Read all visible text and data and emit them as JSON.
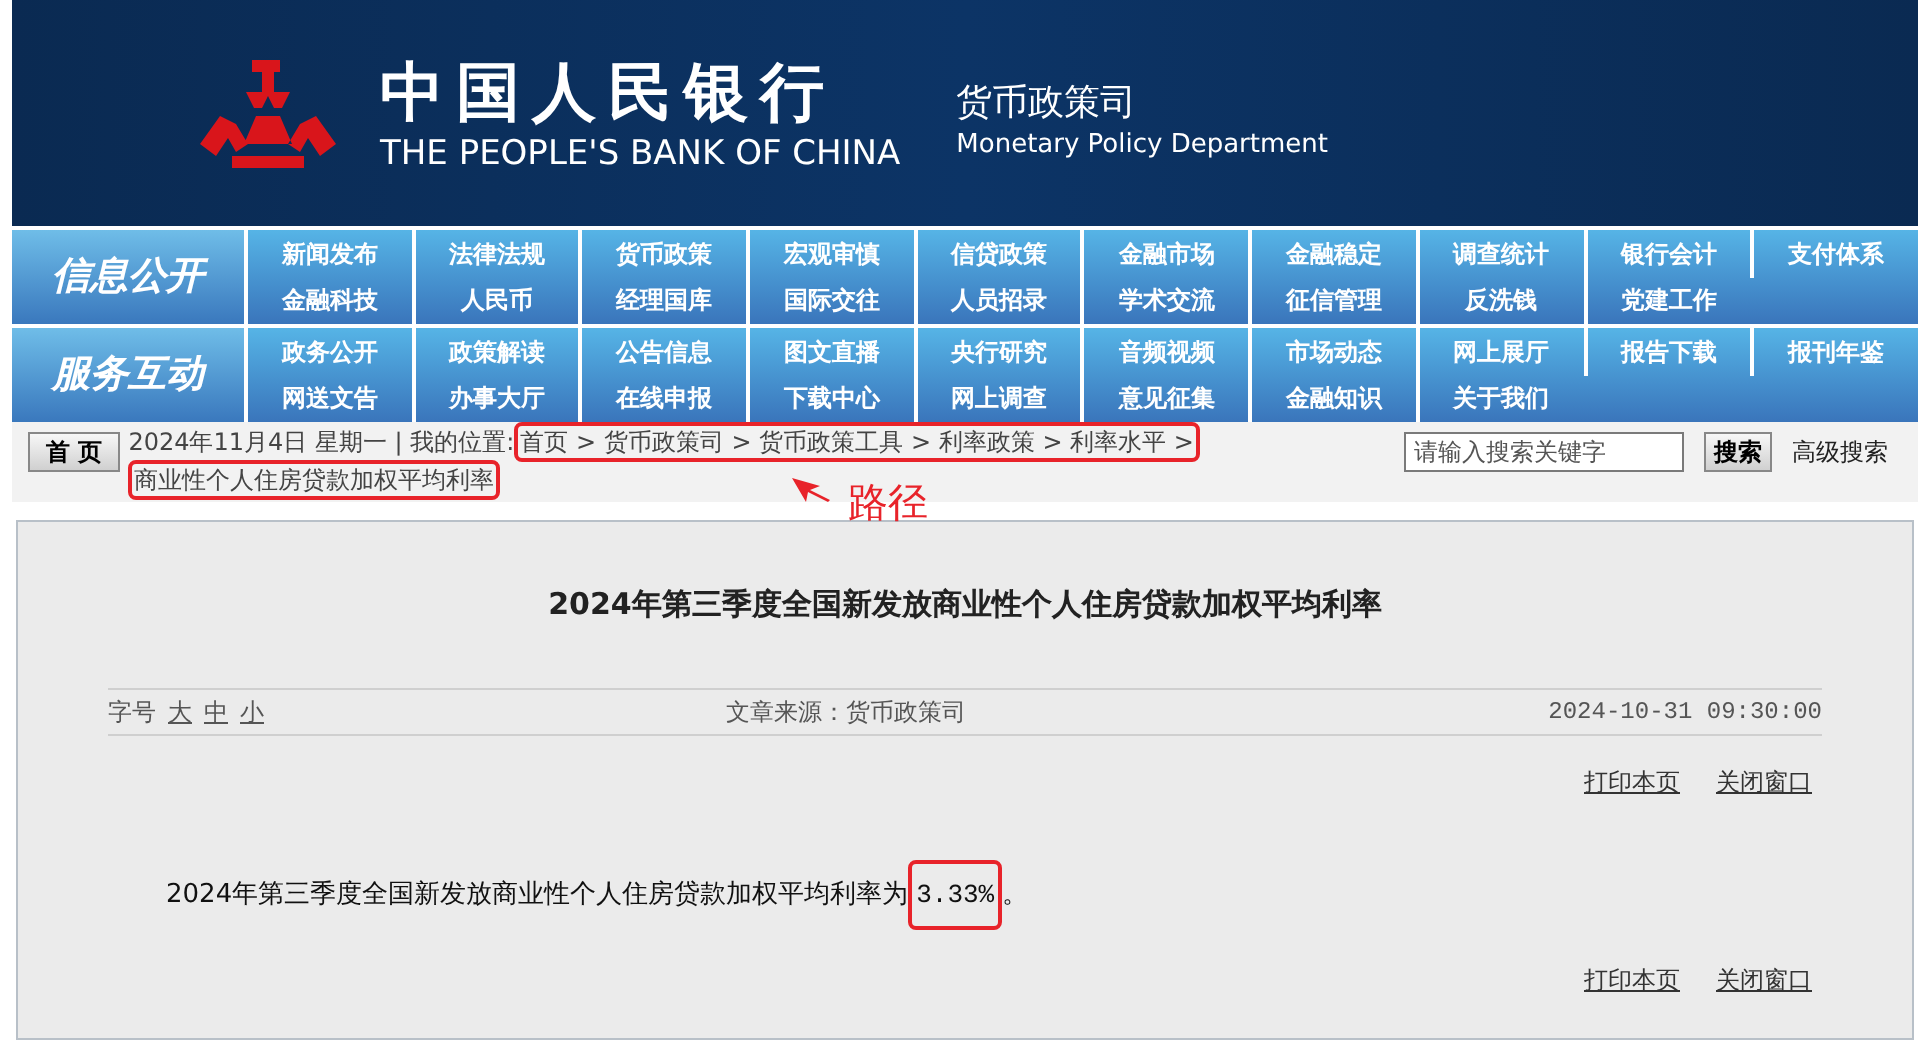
{
  "header": {
    "title_cn": "中国人民银行",
    "title_en": "THE PEOPLE'S BANK OF CHINA",
    "dept_cn": "货币政策司",
    "dept_en": "Monetary Policy Department"
  },
  "nav_sections": [
    {
      "label": "信息公开",
      "rows": [
        [
          "新闻发布",
          "法律法规",
          "货币政策",
          "宏观审慎",
          "信贷政策",
          "金融市场",
          "金融稳定",
          "调查统计",
          "银行会计",
          "支付体系"
        ],
        [
          "金融科技",
          "人民币",
          "经理国库",
          "国际交往",
          "人员招录",
          "学术交流",
          "征信管理",
          "反洗钱",
          "党建工作"
        ]
      ]
    },
    {
      "label": "服务互动",
      "rows": [
        [
          "政务公开",
          "政策解读",
          "公告信息",
          "图文直播",
          "央行研究",
          "音频视频",
          "市场动态",
          "网上展厅",
          "报告下载",
          "报刊年鉴"
        ],
        [
          "网送文告",
          "办事大厅",
          "在线申报",
          "下载中心",
          "网上调查",
          "意见征集",
          "金融知识",
          "关于我们"
        ]
      ]
    }
  ],
  "breadcrumb": {
    "home_button": "首 页",
    "date": "2024年11月4日 星期一",
    "divider": "|",
    "location_label": "我的位置:",
    "crumbs": [
      {
        "label": "首页",
        "sep": ">"
      },
      {
        "label": "货币政策司",
        "sep": ">"
      },
      {
        "label": "货币政策工具",
        "sep": ">"
      },
      {
        "label": "利率政策",
        "sep": ">"
      },
      {
        "label": "利率水平",
        "sep": ">"
      }
    ],
    "current": "商业性个人住房贷款加权平均利率"
  },
  "search": {
    "placeholder": "请输入搜索关键字",
    "button": "搜索",
    "advanced": "高级搜索"
  },
  "annotation": {
    "label": "路径"
  },
  "article": {
    "title": "2024年第三季度全国新发放商业性个人住房贷款加权平均利率",
    "font_size_label": "字号",
    "font_sizes": [
      "大",
      "中",
      "小"
    ],
    "source": "文章来源：货币政策司",
    "date": "2024-10-31 09:30:00",
    "actions_top": [
      "打印本页",
      "关闭窗口"
    ],
    "body_before": "2024年第三季度全国新发放商业性个人住房贷款加权平均利率为",
    "highlight": "3.33%",
    "body_after": "。",
    "actions_bottom": [
      "打印本页",
      "关闭窗口"
    ]
  }
}
